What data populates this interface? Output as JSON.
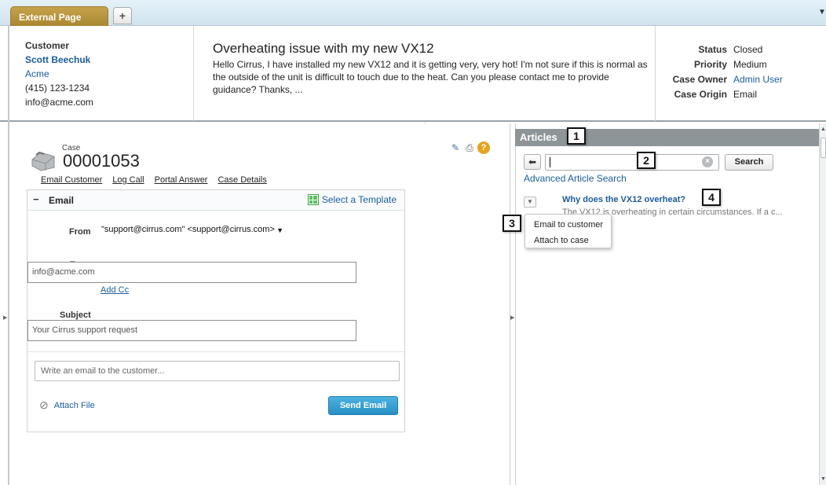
{
  "tabs": {
    "active": "External Page",
    "add": "+"
  },
  "customer": {
    "label": "Customer",
    "name": "Scott Beechuk",
    "account": "Acme",
    "phone": "(415) 123-1234",
    "email": "info@acme.com"
  },
  "case_subject": {
    "title": "Overheating issue with my new VX12",
    "body": "Hello Cirrus, I have installed my new VX12 and it is getting very, very hot! I'm not sure if this is normal as the outside of the unit is difficult to touch due to the heat. Can you please contact me to provide guidance? Thanks, ..."
  },
  "case_status": [
    {
      "label": "Status",
      "value": "Closed",
      "link": false
    },
    {
      "label": "Priority",
      "value": "Medium",
      "link": false
    },
    {
      "label": "Case Owner",
      "value": "Admin User",
      "link": true
    },
    {
      "label": "Case Origin",
      "value": "Email",
      "link": false
    }
  ],
  "case": {
    "label": "Case",
    "number": "00001053",
    "actions": [
      "Email Customer",
      "Log Call",
      "Portal Answer",
      "Case Details"
    ],
    "tool_icons": [
      "edit-icon",
      "print-icon",
      "help-icon"
    ]
  },
  "email": {
    "title": "Email",
    "collapse": "−",
    "select_template": "Select a Template",
    "from_label": "From",
    "from_value": "\"support@cirrus.com\" <support@cirrus.com>",
    "to_label": "To",
    "to_value": "info@acme.com",
    "add_cc": "Add Cc",
    "subject_label": "Subject",
    "subject_value": "Your Cirrus support request",
    "body_placeholder": "Write an email to the customer...",
    "attach_file": "Attach File",
    "send": "Send Email"
  },
  "articles": {
    "title": "Articles",
    "search_button": "Search",
    "advanced_link": "Advanced Article Search",
    "back_icon": "back-arrow-icon",
    "result_title": "Why does the VX12 overheat?",
    "result_snippet": "The VX12 is overheating in certain circumstances. If a c...",
    "menu_items": [
      "Email to customer",
      "Attach to case"
    ]
  },
  "callouts": [
    "1",
    "2",
    "3",
    "4"
  ],
  "colors": {
    "tab_active": "#b59136",
    "link": "#1a5c9e",
    "articles_header": "#8d9599",
    "send_button": "#2e9bd0"
  }
}
